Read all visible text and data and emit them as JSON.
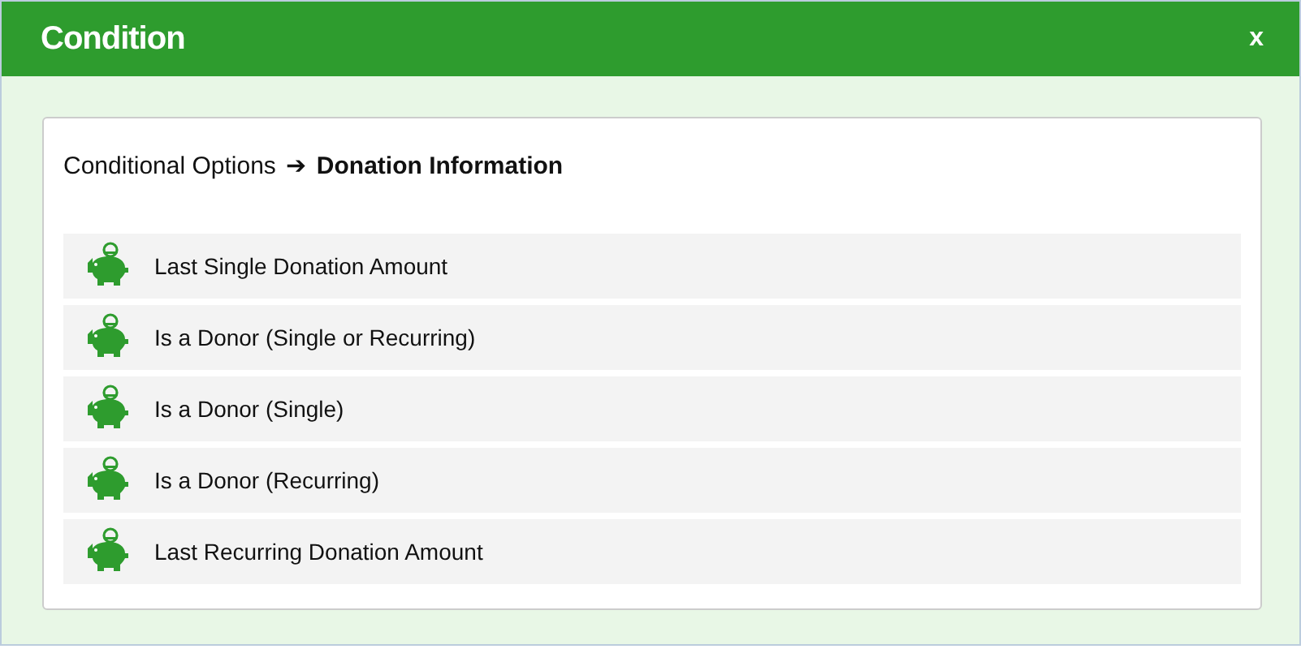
{
  "window": {
    "title": "Condition",
    "close": "x"
  },
  "breadcrumb": {
    "parent": "Conditional Options",
    "separator": "➔",
    "current": "Donation Information"
  },
  "options": [
    {
      "label": "Last Single Donation Amount"
    },
    {
      "label": "Is a Donor (Single or Recurring)"
    },
    {
      "label": "Is a Donor (Single)"
    },
    {
      "label": "Is a Donor (Recurring)"
    },
    {
      "label": "Last Recurring Donation Amount"
    }
  ]
}
